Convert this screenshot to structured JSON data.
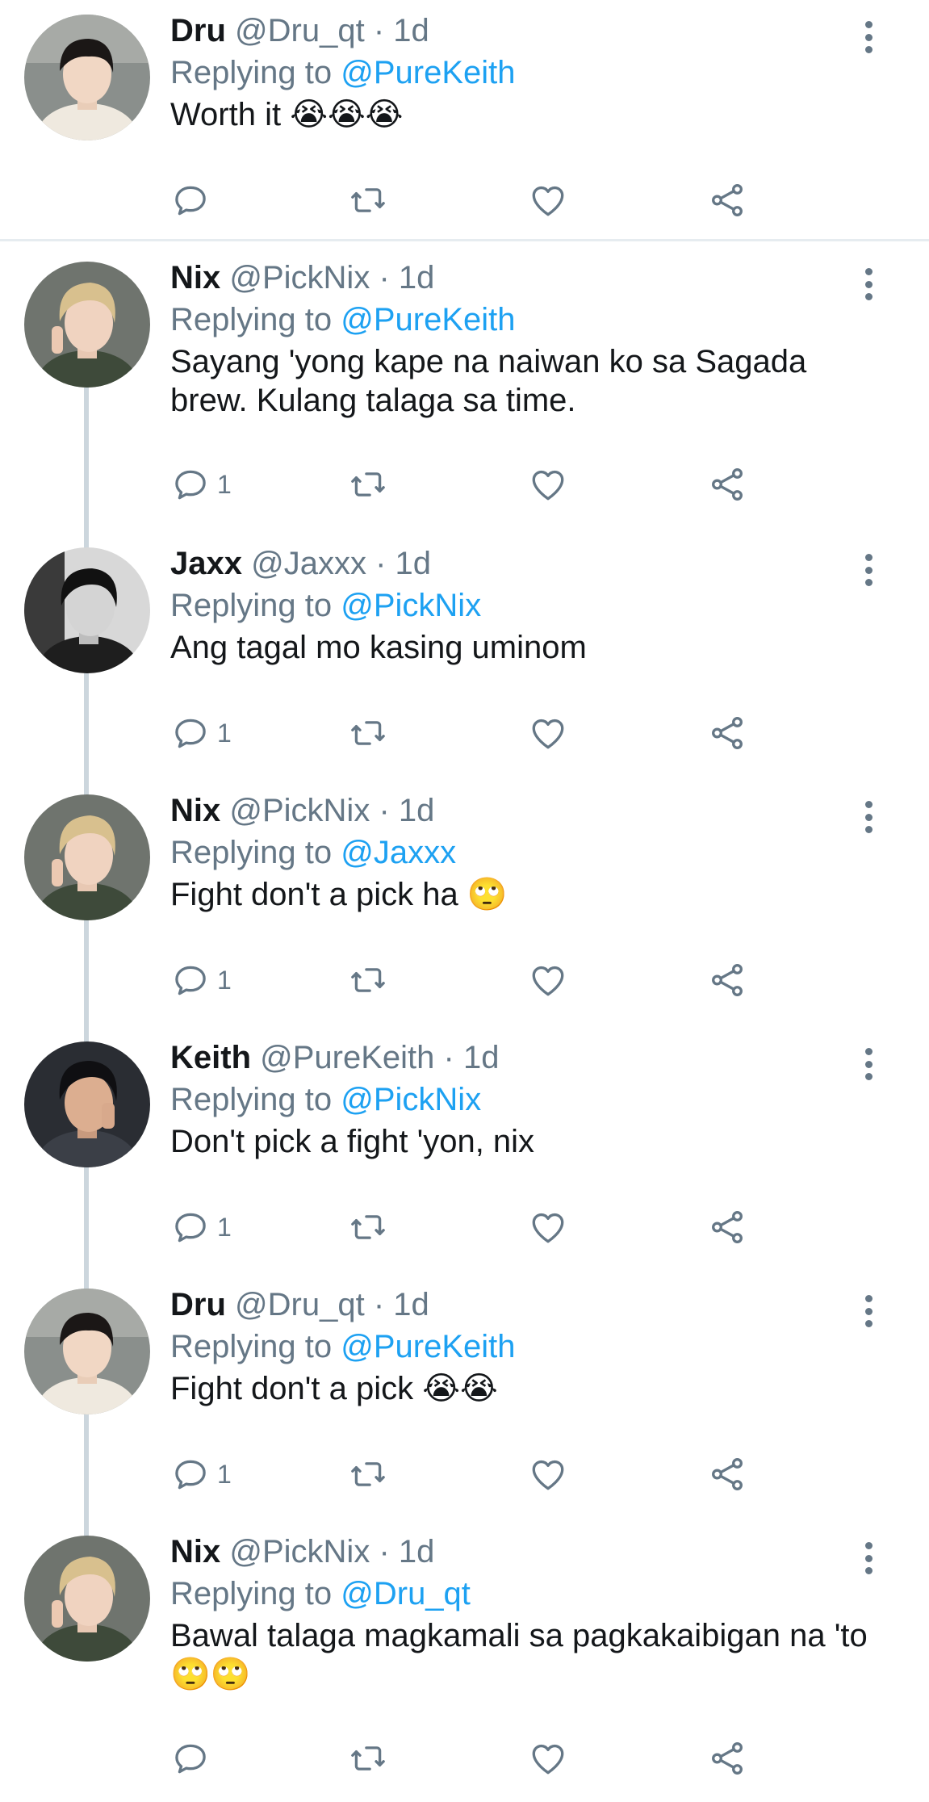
{
  "colors": {
    "text": "#14171a",
    "secondary": "#657786",
    "accent": "#1da1f2",
    "thread_line": "#ccd6dd",
    "divider": "#e6ecf0"
  },
  "icons": {
    "reply": "speech-bubble-icon",
    "retweet": "retweet-arrows-icon",
    "like": "heart-outline-icon",
    "share": "share-nodes-icon",
    "more": "vertical-dots-icon"
  },
  "tweets": [
    {
      "name": "Dru",
      "handle": "@Dru_qt",
      "sep": "·",
      "time": "1d",
      "reply_prefix": "Replying to",
      "reply_to": "@PureKeith",
      "text": "Worth it",
      "emoji": "😭😭😭",
      "reply_count": ""
    },
    {
      "name": "Nix",
      "handle": "@PickNix",
      "sep": "·",
      "time": "1d",
      "reply_prefix": "Replying to",
      "reply_to": "@PureKeith",
      "text": "Sayang 'yong kape na naiwan ko sa Sagada brew. Kulang talaga sa time.",
      "emoji": "",
      "reply_count": "1"
    },
    {
      "name": "Jaxx",
      "handle": "@Jaxxx",
      "sep": "·",
      "time": "1d",
      "reply_prefix": "Replying to",
      "reply_to": "@PickNix",
      "text": "Ang tagal mo kasing uminom",
      "emoji": "",
      "reply_count": "1"
    },
    {
      "name": "Nix",
      "handle": "@PickNix",
      "sep": "·",
      "time": "1d",
      "reply_prefix": "Replying to",
      "reply_to": "@Jaxxx",
      "text": "Fight don't a pick ha",
      "emoji": "🙄",
      "reply_count": "1"
    },
    {
      "name": "Keith",
      "handle": "@PureKeith",
      "sep": "·",
      "time": "1d",
      "reply_prefix": "Replying to",
      "reply_to": "@PickNix",
      "text": "Don't pick a fight 'yon, nix",
      "emoji": "",
      "reply_count": "1"
    },
    {
      "name": "Dru",
      "handle": "@Dru_qt",
      "sep": "·",
      "time": "1d",
      "reply_prefix": "Replying to",
      "reply_to": "@PureKeith",
      "text": "Fight don't a pick",
      "emoji": "😭😭",
      "reply_count": "1"
    },
    {
      "name": "Nix",
      "handle": "@PickNix",
      "sep": "·",
      "time": "1d",
      "reply_prefix": "Replying to",
      "reply_to": "@Dru_qt",
      "text": "Bawal talaga magkamali sa pagkakaibigan na 'to",
      "emoji": "🙄🙄",
      "reply_count": ""
    }
  ]
}
